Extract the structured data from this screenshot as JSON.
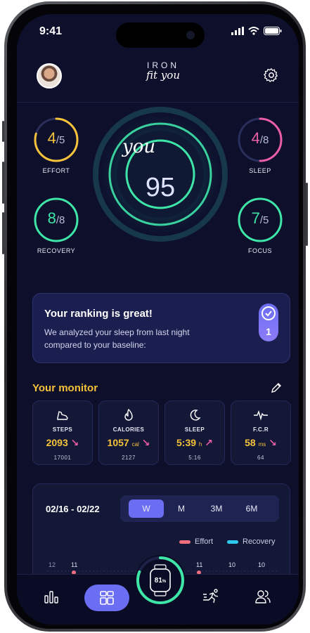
{
  "status": {
    "time": "9:41"
  },
  "header": {
    "logo_line1": "IRON",
    "logo_line2": "fit you",
    "avatar": "user-avatar",
    "settings_icon": "gear-icon"
  },
  "rings": {
    "effort": {
      "value": "4",
      "max": "/5",
      "label": "EFFORT",
      "color": "#f5c23a"
    },
    "sleep": {
      "value": "4",
      "max": "/8",
      "label": "SLEEP",
      "color": "#ec5ea3"
    },
    "recovery": {
      "value": "8",
      "max": "/8",
      "label": "RECOVERY",
      "color": "#3ee6a8"
    },
    "focus": {
      "value": "7",
      "max": "/5",
      "label": "FOCUS",
      "color": "#3ee6a8"
    }
  },
  "main_score": {
    "label": "you",
    "value": "95"
  },
  "ranking": {
    "title": "Your ranking is great!",
    "subtitle": "We analyzed your sleep from last night compared to your baseline:",
    "badge": "1"
  },
  "monitor": {
    "title": "Your monitor",
    "tiles": [
      {
        "label": "STEPS",
        "value": "2093",
        "unit": "",
        "baseline": "17001",
        "icon": "shoe-icon",
        "trend_color": "#ec5ea3"
      },
      {
        "label": "CALORIES",
        "value": "1057",
        "unit": "cal",
        "baseline": "2127",
        "icon": "flame-icon",
        "trend_color": "#ec5ea3"
      },
      {
        "label": "SLEEP",
        "value": "5:39",
        "unit": "h",
        "baseline": "5:16",
        "icon": "moon-icon",
        "trend_color": "#ec5ea3"
      },
      {
        "label": "F.C.R",
        "value": "58",
        "unit": "ms",
        "baseline": "64",
        "icon": "pulse-icon",
        "trend_color": "#ec5ea3"
      }
    ]
  },
  "chart": {
    "range": "02/16 - 02/22",
    "periods": [
      "W",
      "M",
      "3M",
      "6M"
    ],
    "selected_period": "W",
    "legend": [
      {
        "name": "Effort",
        "color": "#ef6f7f"
      },
      {
        "name": "Recovery",
        "color": "#2fc9f0"
      }
    ],
    "y_tick": "12",
    "point_labels": [
      "11",
      "11",
      "10",
      "10"
    ]
  },
  "tabbar": {
    "watch_value": "81",
    "watch_unit": "%",
    "items": [
      "stats-icon",
      "dashboard-icon",
      "watch-icon",
      "activity-icon",
      "people-icon"
    ]
  },
  "accent": "#6b6df3"
}
